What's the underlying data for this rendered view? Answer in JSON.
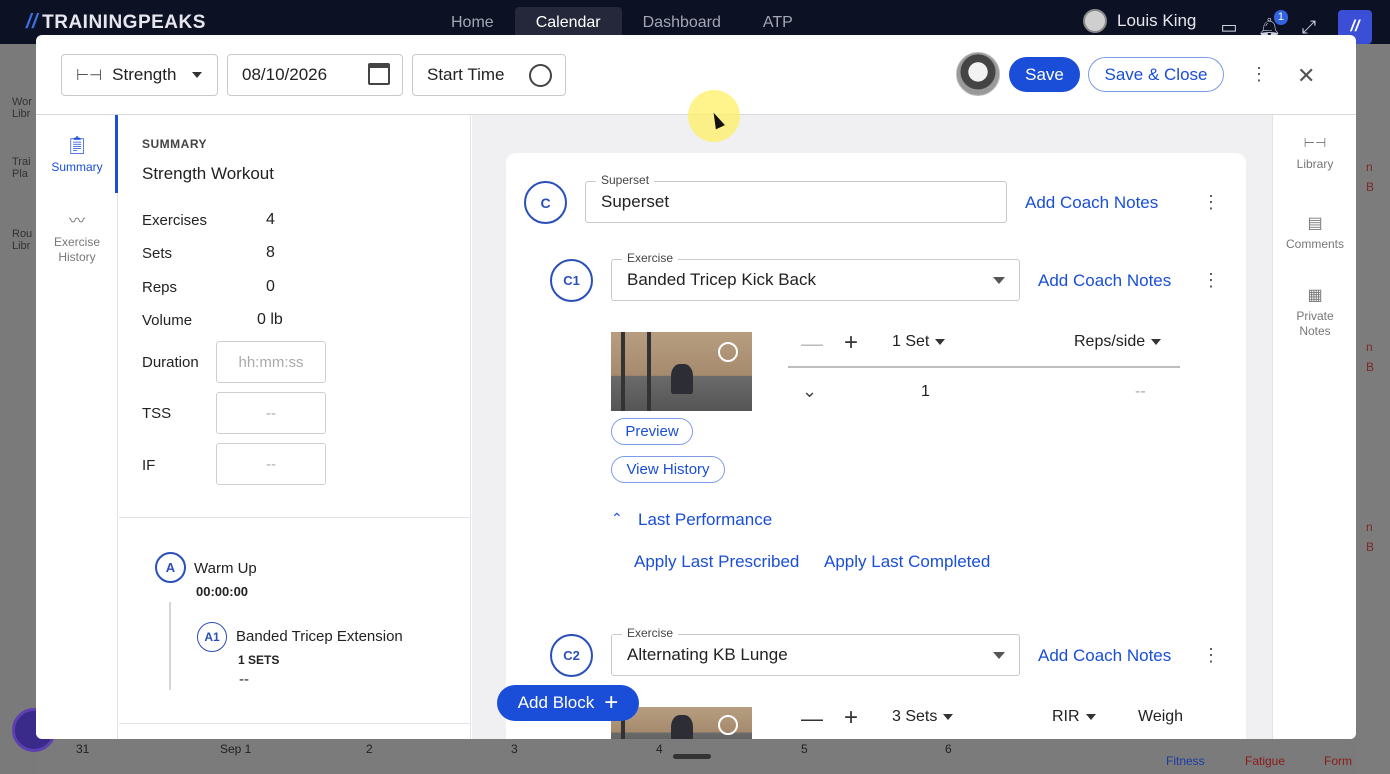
{
  "app": {
    "brand": "TRAININGPEAKS",
    "nav": [
      "Home",
      "Calendar",
      "Dashboard",
      "ATP"
    ],
    "active_nav": "Calendar",
    "user_name": "Louis King",
    "notification_count": "1"
  },
  "background": {
    "left_labels": [
      "Wor\nLibr",
      "Trai\nPla",
      "Rou\nLibr"
    ],
    "right_labels": [
      "n",
      "B",
      "n",
      "B",
      "n",
      "B"
    ],
    "bottom_dates": [
      "31",
      "Sep 1",
      "2",
      "3",
      "4",
      "5",
      "6"
    ],
    "bottom_metrics": [
      "Fitness",
      "Fatigue",
      "Form"
    ]
  },
  "header": {
    "workout_type": "Strength",
    "date": "08/10/2026",
    "start_time_label": "Start Time",
    "save_label": "Save",
    "save_close_label": "Save & Close"
  },
  "left_nav": {
    "summary_label": "Summary",
    "history_label": "Exercise\nHistory"
  },
  "summary": {
    "section_label": "SUMMARY",
    "title": "Strength Workout",
    "stats": [
      {
        "label": "Exercises",
        "value": "4"
      },
      {
        "label": "Sets",
        "value": "8"
      },
      {
        "label": "Reps",
        "value": "0"
      },
      {
        "label": "Volume",
        "value": "0 lb"
      }
    ],
    "duration_label": "Duration",
    "duration_placeholder": "hh:mm:ss",
    "tss_label": "TSS",
    "tss_value": "--",
    "if_label": "IF",
    "if_value": "--",
    "blocks": [
      {
        "badge": "A",
        "name": "Warm Up",
        "time": "00:00:00"
      }
    ],
    "exercises": [
      {
        "badge": "A1",
        "name": "Banded Tricep Extension",
        "sets": "1 SETS",
        "detail": "--"
      }
    ]
  },
  "main": {
    "superset": {
      "badge": "C",
      "field_label": "Superset",
      "value": "Superset",
      "coach_notes": "Add Coach Notes"
    },
    "exercise1": {
      "badge": "C1",
      "field_label": "Exercise",
      "name": "Banded Tricep Kick Back",
      "coach_notes": "Add Coach Notes",
      "preview_label": "Preview",
      "history_label": "View History",
      "sets_label": "1 Set",
      "metric_label": "Reps/side",
      "row_index": "1",
      "row_value": "--",
      "last_perf_label": "Last Performance",
      "apply_prescribed": "Apply Last Prescribed",
      "apply_completed": "Apply Last Completed"
    },
    "exercise2": {
      "badge": "C2",
      "field_label": "Exercise",
      "name": "Alternating KB Lunge",
      "coach_notes": "Add Coach Notes",
      "sets_label": "3 Sets",
      "metric1": "RIR",
      "metric2": "Weigh"
    },
    "add_block_label": "Add Block"
  },
  "right_nav": {
    "library_label": "Library",
    "comments_label": "Comments",
    "private_notes_label": "Private\nNotes"
  }
}
